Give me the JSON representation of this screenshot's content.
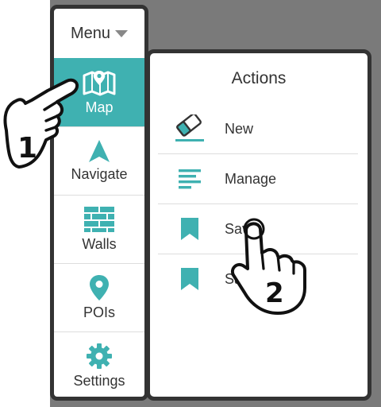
{
  "menu": {
    "header_label": "Menu",
    "items": [
      {
        "label": "Map",
        "icon": "map-icon",
        "active": true
      },
      {
        "label": "Navigate",
        "icon": "navigate-arrow-icon",
        "active": false
      },
      {
        "label": "Walls",
        "icon": "brick-wall-icon",
        "active": false
      },
      {
        "label": "POIs",
        "icon": "location-pin-icon",
        "active": false
      },
      {
        "label": "Settings",
        "icon": "gear-icon",
        "active": false
      }
    ]
  },
  "actions": {
    "title": "Actions",
    "items": [
      {
        "label": "New",
        "icon": "eraser-icon"
      },
      {
        "label": "Manage",
        "icon": "lines-icon"
      },
      {
        "label": "Save",
        "icon": "bookmark-icon"
      },
      {
        "label": "Sav",
        "icon": "bookmark-icon"
      }
    ]
  },
  "callouts": {
    "step1": "1",
    "step2": "2"
  },
  "colors": {
    "accent": "#3fb1b1",
    "frame": "#333333",
    "backdrop": "#7a7a7a"
  }
}
